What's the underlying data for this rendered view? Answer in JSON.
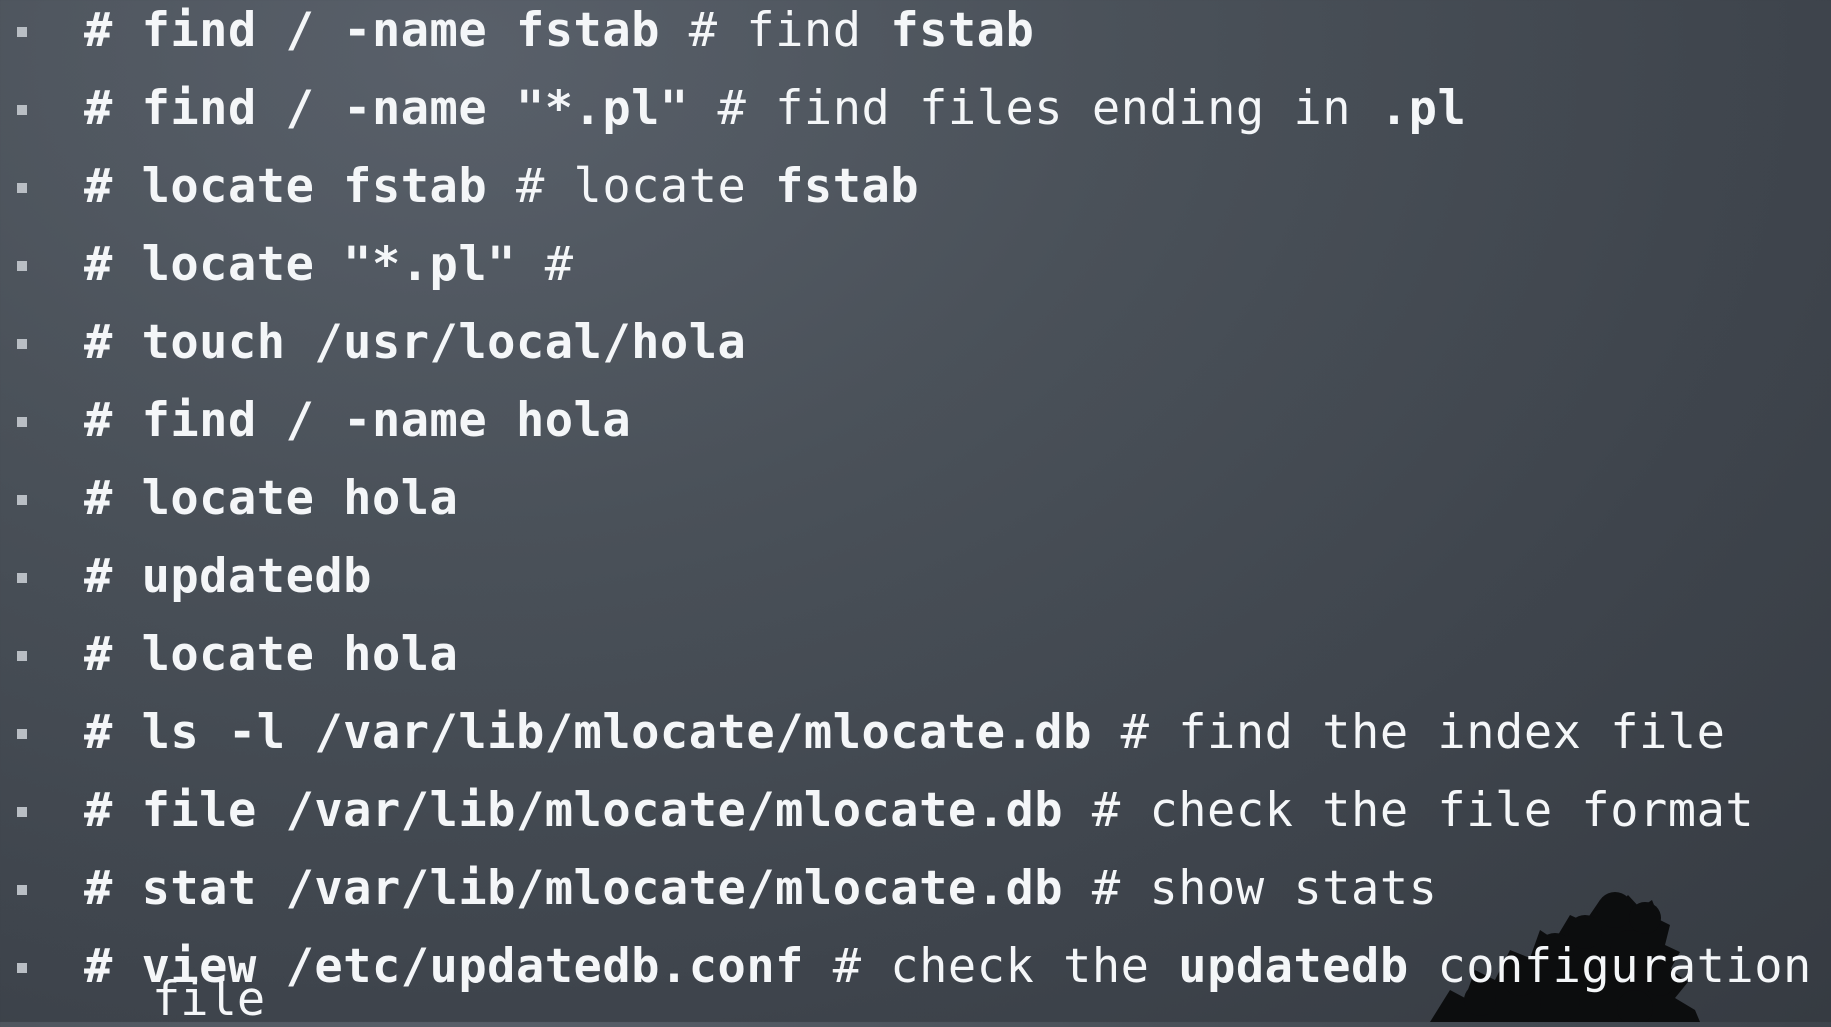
{
  "slide": {
    "background_colors": [
      "#59606a",
      "#3e444c"
    ],
    "bullet_color": "#b9bec4",
    "text_color": "#f4f6f8"
  },
  "commands": [
    {
      "prompt": "#",
      "cmd": "find / -name fstab",
      "comment_lead": "# find ",
      "comment_bold": "fstab",
      "comment_tail": ""
    },
    {
      "prompt": "#",
      "cmd": "find / -name \"*.pl\"",
      "comment_lead": "# find files ending in ",
      "comment_bold": ".pl",
      "comment_tail": ""
    },
    {
      "prompt": "#",
      "cmd": "locate fstab",
      "comment_lead": "# locate ",
      "comment_bold": "fstab",
      "comment_tail": ""
    },
    {
      "prompt": "#",
      "cmd": "locate \"*.pl\"",
      "comment_lead": "#",
      "comment_bold": "",
      "comment_tail": ""
    },
    {
      "prompt": "#",
      "cmd": "touch /usr/local/hola",
      "comment_lead": "",
      "comment_bold": "",
      "comment_tail": ""
    },
    {
      "prompt": "#",
      "cmd": "find / -name hola",
      "comment_lead": "",
      "comment_bold": "",
      "comment_tail": ""
    },
    {
      "prompt": "#",
      "cmd": "locate hola",
      "comment_lead": "",
      "comment_bold": "",
      "comment_tail": ""
    },
    {
      "prompt": "#",
      "cmd": "updatedb",
      "comment_lead": "",
      "comment_bold": "",
      "comment_tail": ""
    },
    {
      "prompt": "#",
      "cmd": "locate hola",
      "comment_lead": "",
      "comment_bold": "",
      "comment_tail": ""
    },
    {
      "prompt": "#",
      "cmd": "ls -l /var/lib/mlocate/mlocate.db",
      "comment_lead": "# find the index file",
      "comment_bold": "",
      "comment_tail": ""
    },
    {
      "prompt": "#",
      "cmd": "file /var/lib/mlocate/mlocate.db",
      "comment_lead": "# check the file format",
      "comment_bold": "",
      "comment_tail": ""
    },
    {
      "prompt": "#",
      "cmd": "stat /var/lib/mlocate/mlocate.db",
      "comment_lead": "# show stats",
      "comment_bold": "",
      "comment_tail": ""
    },
    {
      "prompt": "#",
      "cmd": "view /etc/updatedb.conf",
      "comment_lead": "# check the ",
      "comment_bold": "updatedb",
      "comment_tail": " configuration"
    }
  ],
  "wrap_text": "file"
}
